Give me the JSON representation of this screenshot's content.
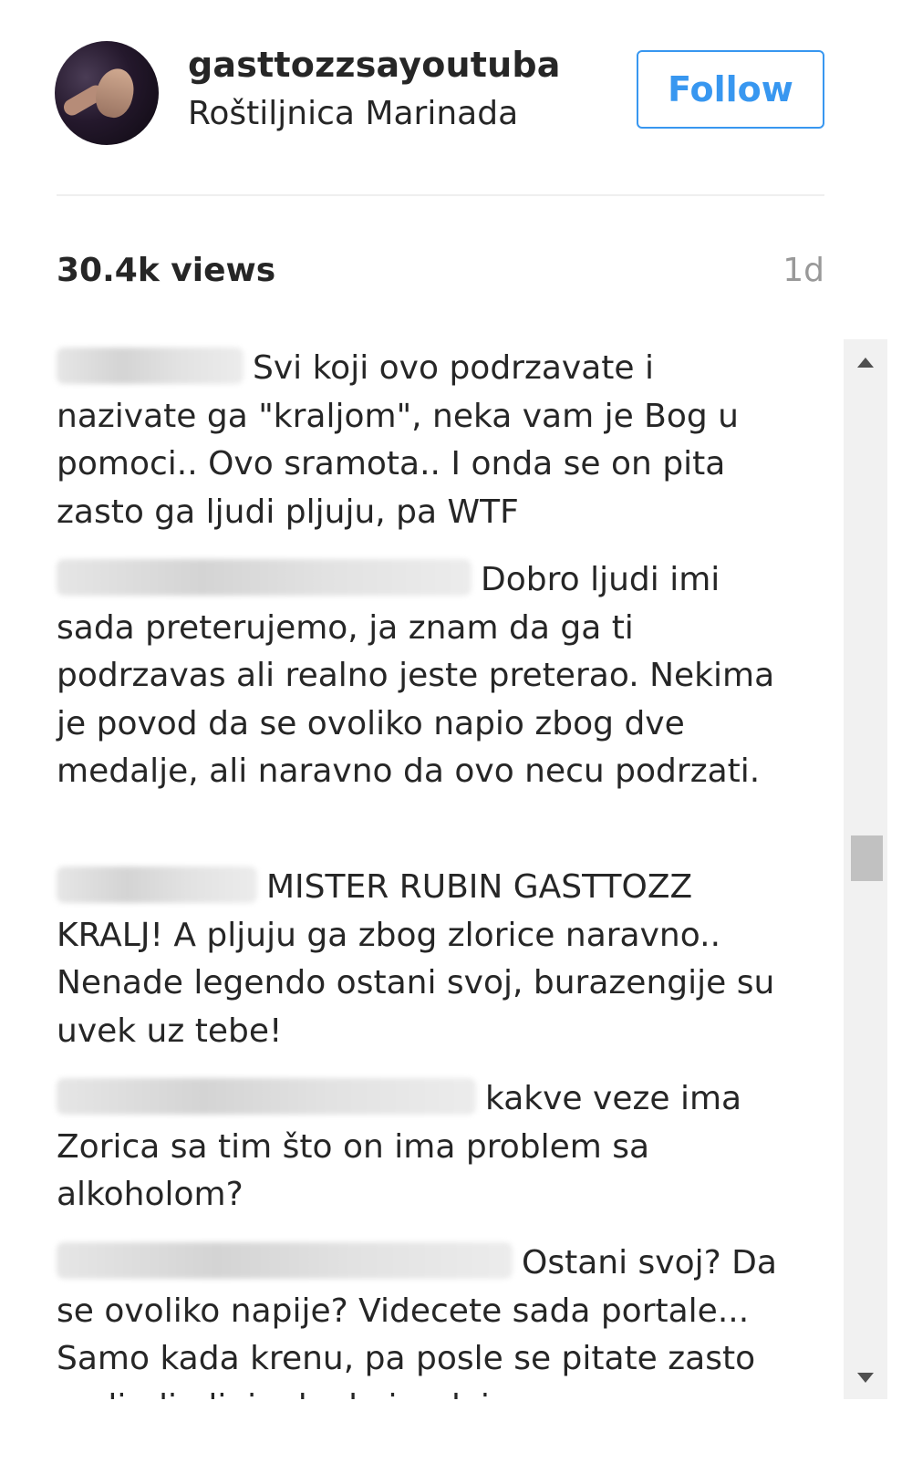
{
  "post": {
    "username": "gasttozzsayoutuba",
    "location": "Roštiljnica Marinada",
    "follow_label": "Follow",
    "views": "30.4k views",
    "time": "1d"
  },
  "colors": {
    "follow_blue": "#3897f0",
    "text": "#262626",
    "muted": "#999999"
  },
  "comments": [
    {
      "text": "Svi koji ovo podrzavate i nazivate ga \"kraljom\", neka vam je Bog u pomoci.. Ovo sramota.. I onda se on pita zasto ga ljudi pljuju, pa WTF"
    },
    {
      "text": "Dobro ljudi imi sada preterujemo, ja znam da ga ti podrzavas ali realno jeste preterao. Nekima je povod da se ovoliko napio zbog dve medalje, ali naravno da ovo necu podrzati."
    },
    {
      "text": "MISTER RUBIN GASTTOZZ KRALJ! A pljuju ga zbog zlorice naravno.. Nenade legendo ostani svoj, burazengije su uvek uz tebe!"
    },
    {
      "text": "kakve veze ima Zorica sa tim što on ima problem sa alkoholom?"
    },
    {
      "text": "Ostani svoj? Da se ovoliko napije? Videcete sada portale... Samo kada krenu, pa posle se pitate zasto ga ljudi pljuju, kada im daje"
    }
  ]
}
